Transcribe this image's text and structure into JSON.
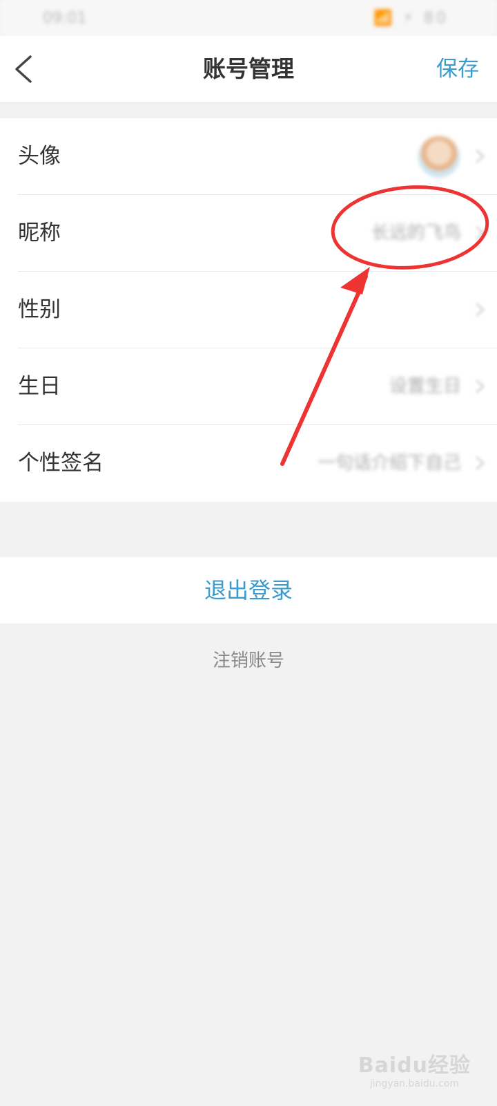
{
  "status_bar": {
    "time": "09:01",
    "icons": "📶 ⚡ 80"
  },
  "nav": {
    "title": "账号管理",
    "save_label": "保存"
  },
  "settings": {
    "items": [
      {
        "label": "头像",
        "value": ""
      },
      {
        "label": "昵称",
        "value": "长远的飞鸟"
      },
      {
        "label": "性别",
        "value": ""
      },
      {
        "label": "生日",
        "value": "设置生日"
      },
      {
        "label": "个性签名",
        "value": "一句话介绍下自己"
      }
    ]
  },
  "logout_label": "退出登录",
  "deactivate_label": "注销账号",
  "watermark": {
    "logo": "Baidu经验",
    "url": "jingyan.baidu.com"
  },
  "colors": {
    "accent": "#3a9bcc",
    "annotation": "#ee3333",
    "background": "#f2f2f2"
  },
  "icons": [
    "back-chevron-icon",
    "chevron-right-icon",
    "avatar"
  ]
}
